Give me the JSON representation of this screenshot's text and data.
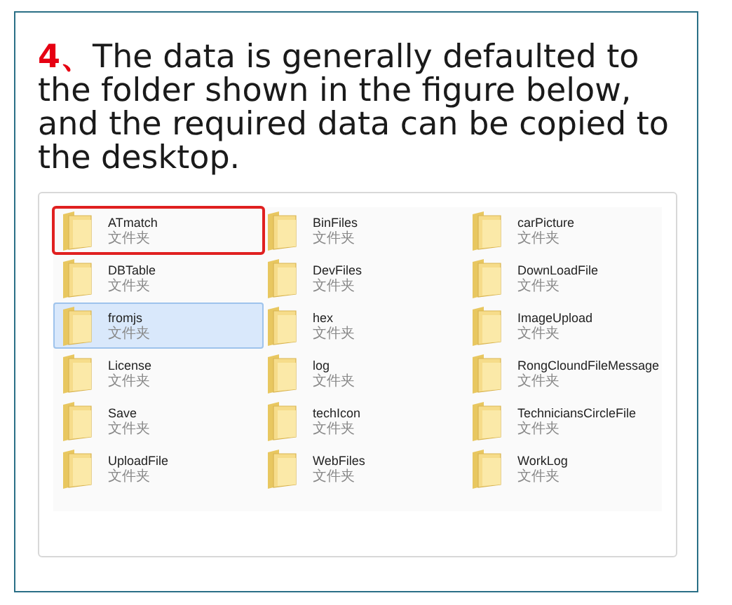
{
  "heading": {
    "number": "4、",
    "text": "The data is generally defaulted to the folder shown in the figure below, and the required data can be copied to the desktop."
  },
  "folders": [
    {
      "name": "ATmatch",
      "type": "文件夹",
      "selected": false,
      "marked": true
    },
    {
      "name": "BinFiles",
      "type": "文件夹",
      "selected": false,
      "marked": false
    },
    {
      "name": "carPicture",
      "type": "文件夹",
      "selected": false,
      "marked": false
    },
    {
      "name": "DBTable",
      "type": "文件夹",
      "selected": false,
      "marked": false
    },
    {
      "name": "DevFiles",
      "type": "文件夹",
      "selected": false,
      "marked": false
    },
    {
      "name": "DownLoadFile",
      "type": "文件夹",
      "selected": false,
      "marked": false
    },
    {
      "name": "fromjs",
      "type": "文件夹",
      "selected": true,
      "marked": false
    },
    {
      "name": "hex",
      "type": "文件夹",
      "selected": false,
      "marked": false
    },
    {
      "name": "ImageUpload",
      "type": "文件夹",
      "selected": false,
      "marked": false
    },
    {
      "name": "License",
      "type": "文件夹",
      "selected": false,
      "marked": false
    },
    {
      "name": "log",
      "type": "文件夹",
      "selected": false,
      "marked": false
    },
    {
      "name": "RongCloundFileMessage",
      "type": "文件夹",
      "selected": false,
      "marked": false
    },
    {
      "name": "Save",
      "type": "文件夹",
      "selected": false,
      "marked": false
    },
    {
      "name": "techIcon",
      "type": "文件夹",
      "selected": false,
      "marked": false
    },
    {
      "name": "TechniciansCircleFile",
      "type": "文件夹",
      "selected": false,
      "marked": false
    },
    {
      "name": "UploadFile",
      "type": "文件夹",
      "selected": false,
      "marked": false
    },
    {
      "name": "WebFiles",
      "type": "文件夹",
      "selected": false,
      "marked": false
    },
    {
      "name": "WorkLog",
      "type": "文件夹",
      "selected": false,
      "marked": false
    }
  ]
}
